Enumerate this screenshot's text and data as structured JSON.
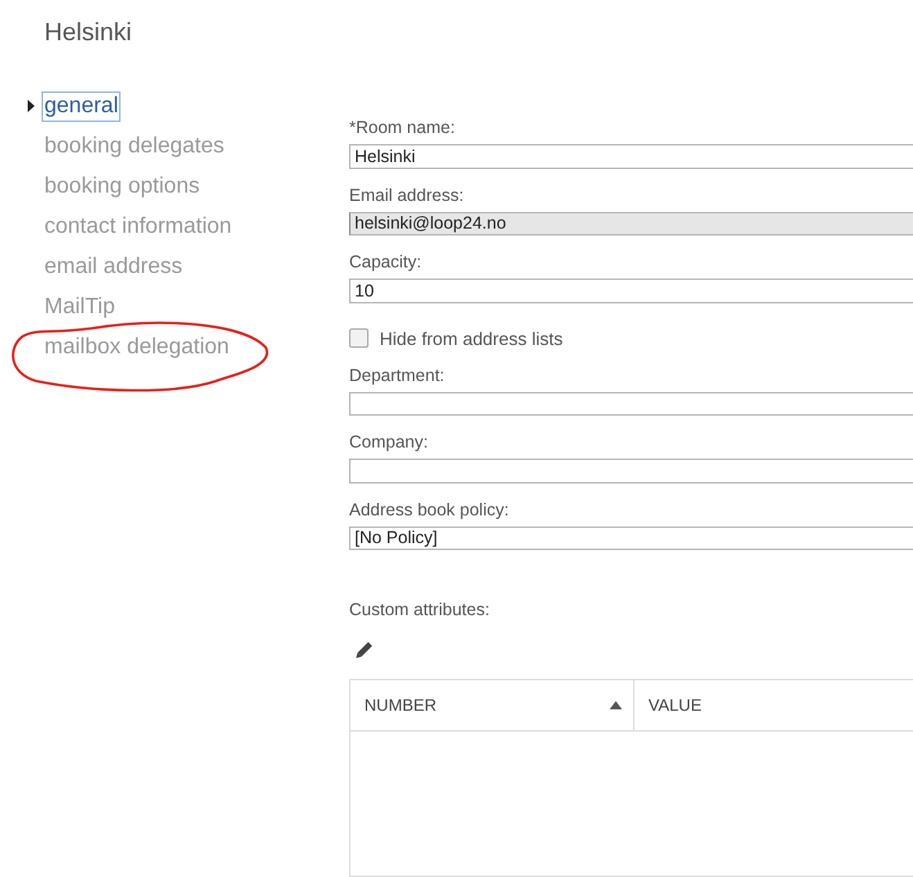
{
  "title": "Helsinki",
  "nav": [
    {
      "label": "general",
      "selected": true,
      "circled": false
    },
    {
      "label": "booking delegates",
      "selected": false,
      "circled": false
    },
    {
      "label": "booking options",
      "selected": false,
      "circled": false
    },
    {
      "label": "contact information",
      "selected": false,
      "circled": false
    },
    {
      "label": "email address",
      "selected": false,
      "circled": false
    },
    {
      "label": "MailTip",
      "selected": false,
      "circled": false
    },
    {
      "label": "mailbox delegation",
      "selected": false,
      "circled": true
    }
  ],
  "form": [
    {
      "kind": "text",
      "label": "*Room name:",
      "value": "Helsinki",
      "disabled": false
    },
    {
      "kind": "text",
      "label": "Email address:",
      "value": "helsinki@loop24.no",
      "disabled": true
    },
    {
      "kind": "text",
      "label": "Capacity:",
      "value": "10",
      "disabled": false
    },
    {
      "kind": "checkbox",
      "label": "Hide from address lists",
      "checked": false
    },
    {
      "kind": "text",
      "label": "Department:",
      "disabled": false
    },
    {
      "kind": "text",
      "label": "Company:",
      "disabled": false
    },
    {
      "kind": "text",
      "label": "Address book policy:",
      "value": "[No Policy]",
      "disabled": false
    }
  ],
  "custom_attributes": {
    "label": "Custom attributes:",
    "columns": [
      {
        "label": "NUMBER",
        "sorted": true
      },
      {
        "label": "VALUE",
        "sorted": false
      }
    ]
  }
}
